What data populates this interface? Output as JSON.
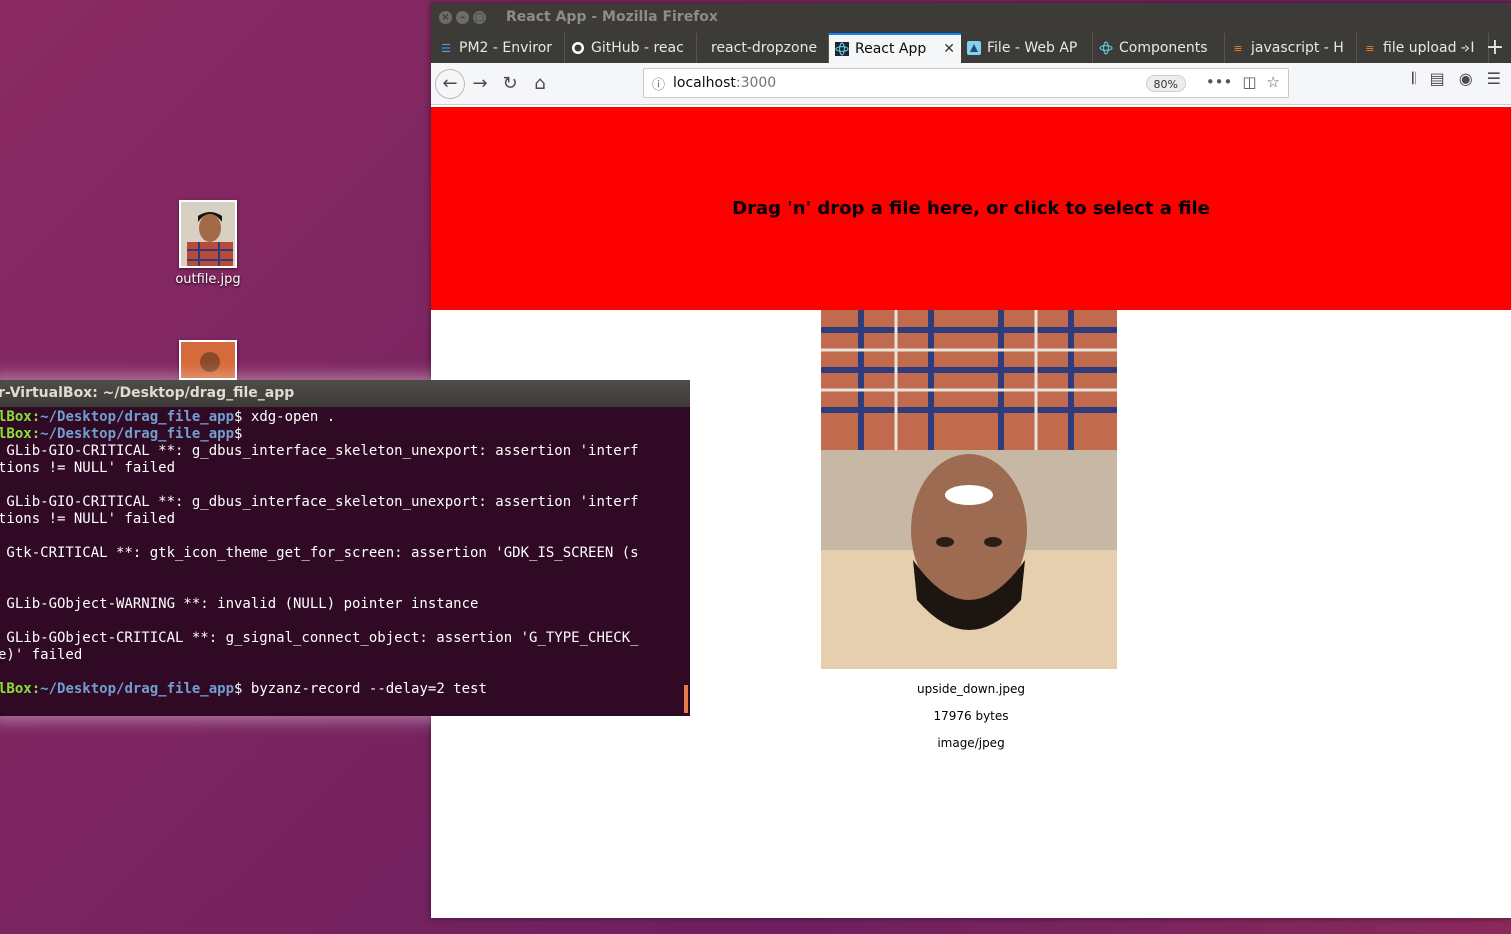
{
  "desktop": {
    "icons": [
      {
        "label": "outfile.jpg"
      },
      {
        "label": ""
      }
    ]
  },
  "browser": {
    "window_title": "React App - Mozilla Firefox",
    "tabs": [
      {
        "label": "PM2 - Enviror",
        "icon": "list-icon"
      },
      {
        "label": "GitHub - reac",
        "icon": "github-icon"
      },
      {
        "label": "react-dropzone",
        "icon": "none"
      },
      {
        "label": "React App",
        "icon": "react-icon",
        "active": true
      },
      {
        "label": "File - Web AP",
        "icon": "mdn-icon"
      },
      {
        "label": "Components",
        "icon": "react-icon"
      },
      {
        "label": "javascript - H",
        "icon": "stackoverflow-icon"
      },
      {
        "label": "file upload - I",
        "icon": "stackoverflow-icon"
      }
    ],
    "url": {
      "host": "localhost",
      "port": ":3000"
    },
    "zoom": "80%"
  },
  "page": {
    "dropzone_text": "Drag 'n' drop a file here, or click to select a file",
    "dropzone_color": "#ff0000",
    "file": {
      "name": "upside_down.jpeg",
      "size": "17976 bytes",
      "type": "image/jpeg"
    }
  },
  "terminal": {
    "title": "r-VirtualBox: ~/Desktop/drag_file_app",
    "prompt_user": "lBox:",
    "prompt_path": "~/Desktop/drag_file_app",
    "prompt_user_short": "ilBox:",
    "lines": [
      {
        "kind": "prompt",
        "cmd": " xdg-open ."
      },
      {
        "kind": "prompt",
        "cmd": ""
      },
      {
        "kind": "out",
        "text": " GLib-GIO-CRITICAL **: g_dbus_interface_skeleton_unexport: assertion 'interf"
      },
      {
        "kind": "out",
        "text": "tions != NULL' failed"
      },
      {
        "kind": "out",
        "text": ""
      },
      {
        "kind": "out",
        "text": " GLib-GIO-CRITICAL **: g_dbus_interface_skeleton_unexport: assertion 'interf"
      },
      {
        "kind": "out",
        "text": "tions != NULL' failed"
      },
      {
        "kind": "out",
        "text": ""
      },
      {
        "kind": "out",
        "text": " Gtk-CRITICAL **: gtk_icon_theme_get_for_screen: assertion 'GDK_IS_SCREEN (s"
      },
      {
        "kind": "out",
        "text": ""
      },
      {
        "kind": "out",
        "text": ""
      },
      {
        "kind": "out",
        "text": " GLib-GObject-WARNING **: invalid (NULL) pointer instance"
      },
      {
        "kind": "out",
        "text": ""
      },
      {
        "kind": "out",
        "text": " GLib-GObject-CRITICAL **: g_signal_connect_object: assertion 'G_TYPE_CHECK_"
      },
      {
        "kind": "out",
        "text": "e)' failed"
      },
      {
        "kind": "out",
        "text": ""
      },
      {
        "kind": "prompt",
        "cmd": " byzanz-record --delay=2 test"
      }
    ]
  }
}
